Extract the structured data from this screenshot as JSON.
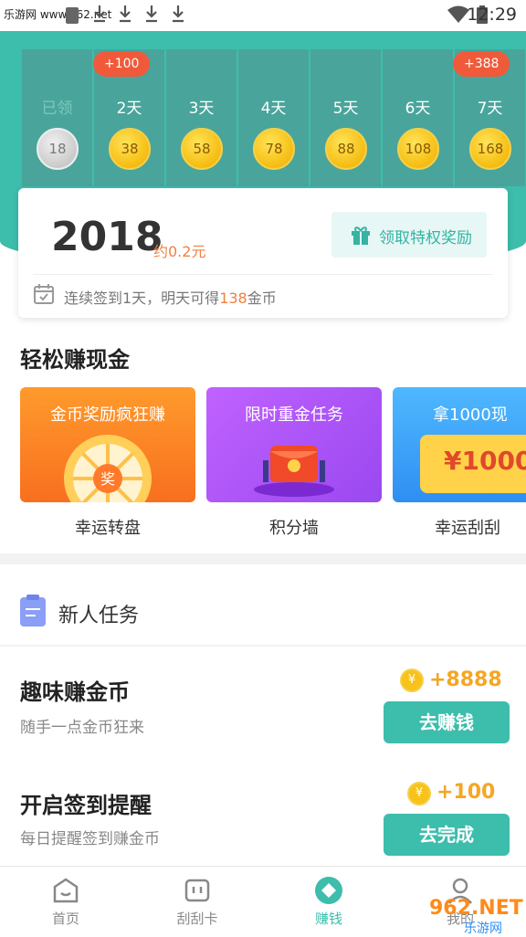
{
  "status_bar": {
    "source_text": "乐游网 www.962.net",
    "time": "12:29"
  },
  "checkin": {
    "days": [
      {
        "label": "已领",
        "coins": "18",
        "claimed": true
      },
      {
        "label": "2天",
        "coins": "38",
        "bonus": "+100"
      },
      {
        "label": "3天",
        "coins": "58"
      },
      {
        "label": "4天",
        "coins": "78"
      },
      {
        "label": "5天",
        "coins": "88"
      },
      {
        "label": "6天",
        "coins": "108"
      },
      {
        "label": "7天",
        "coins": "168",
        "bonus": "+388"
      }
    ]
  },
  "balance": {
    "coins": "2018",
    "yuan": "约0.2元",
    "privilege_button": "领取特权奖励",
    "streak_prefix": "连续签到1天，明天可得",
    "streak_amount": "138",
    "streak_suffix": "金币"
  },
  "earn": {
    "title": "轻松赚现金",
    "tiles": [
      {
        "banner": "金币奖励疯狂赚",
        "label": "幸运转盘"
      },
      {
        "banner": "限时重金任务",
        "label": "积分墙"
      },
      {
        "banner": "拿1000现",
        "label": "幸运刮刮",
        "prize": "¥1000"
      }
    ]
  },
  "tasks": {
    "header": "新人任务",
    "items": [
      {
        "title": "趣味赚金币",
        "desc": "随手一点金币狂来",
        "reward": "+8888",
        "button": "去赚钱"
      },
      {
        "title": "开启签到提醒",
        "desc": "每日提醒签到赚金币",
        "reward": "+100",
        "button": "去完成"
      }
    ]
  },
  "nav": {
    "items": [
      "首页",
      "刮刮卡",
      "赚钱",
      "我的"
    ],
    "active_index": 2
  },
  "watermark": {
    "text": "962.NET",
    "subtext": "乐游网"
  },
  "colors": {
    "teal": "#3dbdac",
    "orange": "#f08040",
    "gold": "#f5a623",
    "red_badge": "#f05a3a"
  }
}
